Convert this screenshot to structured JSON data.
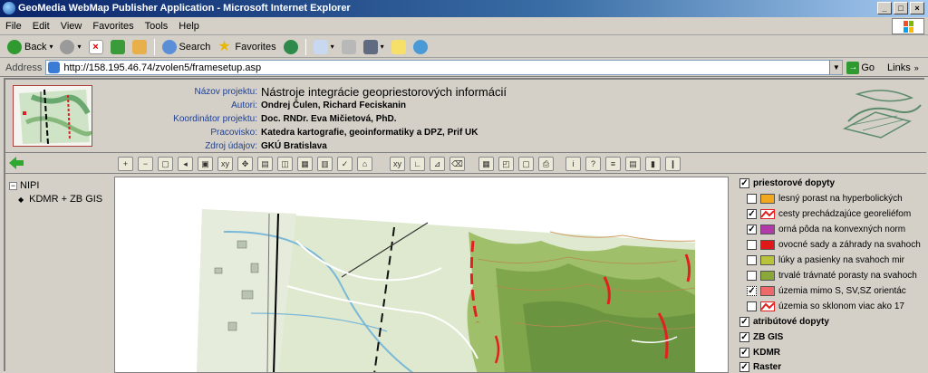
{
  "window": {
    "title": "GeoMedia WebMap Publisher Application - Microsoft Internet Explorer"
  },
  "menu": [
    "File",
    "Edit",
    "View",
    "Favorites",
    "Tools",
    "Help"
  ],
  "toolbar": {
    "back": "Back",
    "search": "Search",
    "favorites": "Favorites"
  },
  "address": {
    "label": "Address",
    "url": "http://158.195.46.74/zvolen5/framesetup.asp",
    "go": "Go",
    "links": "Links"
  },
  "project": {
    "rows": [
      {
        "label": "Názov projektu:",
        "value": "Nástroje integrácie geopriestorových informácií"
      },
      {
        "label": "Autori:",
        "value": "Ondrej Čulen, Richard Feciskanin"
      },
      {
        "label": "Koordinátor projektu:",
        "value": "Doc. RNDr. Eva Mičietová, PhD."
      },
      {
        "label": "Pracovisko:",
        "value": "Katedra kartografie, geoinformatiky a DPZ, Prif UK"
      },
      {
        "label": "Zdroj údajov:",
        "value": "GKÚ Bratislava"
      }
    ]
  },
  "tree": {
    "root": "NIPI",
    "child": "KDMR + ZB GIS"
  },
  "legend": {
    "group1": {
      "label": "priestorové dopyty",
      "checked": true
    },
    "items": [
      {
        "label": "lesný porast na hyperbolických",
        "checked": false,
        "color": "#f2a81e"
      },
      {
        "label": "cesty prechádzajúce georeliéfom",
        "checked": true,
        "color": "#e22020"
      },
      {
        "label": "orná pôda na konvexných norm",
        "checked": true,
        "color": "#b03aa8"
      },
      {
        "label": "ovocné sady a záhrady na svahoch",
        "checked": false,
        "color": "#e01818"
      },
      {
        "label": "lúky a pasienky na svahoch mir",
        "checked": false,
        "color": "#b8c23a"
      },
      {
        "label": "trvalé trávnaté porasty na svahoch",
        "checked": false,
        "color": "#8aa83a"
      },
      {
        "label": "územia mimo S, SV,SZ orientác",
        "checked": true,
        "color": "#ee6a6a"
      },
      {
        "label": "územia so sklonom viac ako 17",
        "checked": false,
        "color": "#e22020"
      }
    ],
    "groups": [
      {
        "label": "atribútové dopyty",
        "checked": true
      },
      {
        "label": "ZB GIS",
        "checked": true
      },
      {
        "label": "KDMR",
        "checked": true
      },
      {
        "label": "Raster",
        "checked": true
      }
    ]
  }
}
